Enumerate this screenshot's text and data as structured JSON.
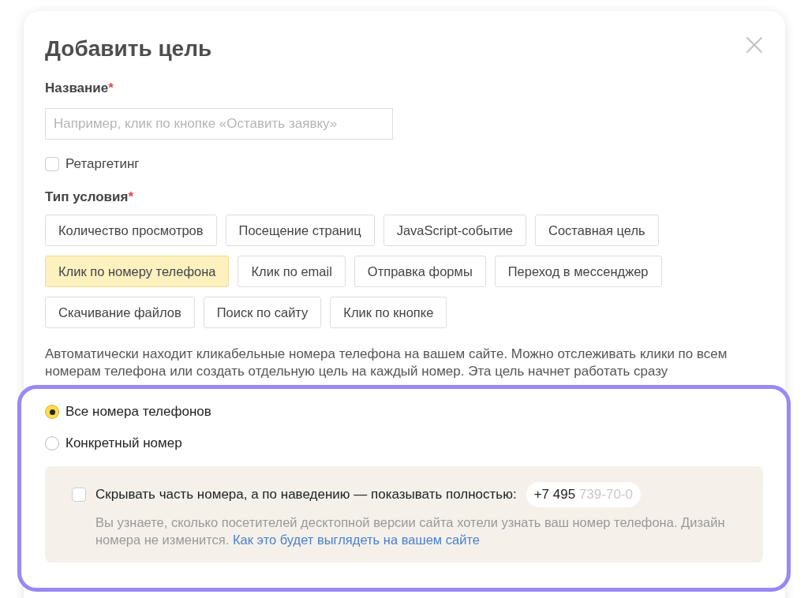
{
  "dialog": {
    "title": "Добавить цель",
    "name_field": {
      "label": "Название",
      "required_mark": "*",
      "placeholder": "Например, клик по кнопке «Оставить заявку»"
    },
    "retargeting": {
      "label": "Ретаргетинг",
      "checked": false
    },
    "condition_type": {
      "label": "Тип условия",
      "required_mark": "*",
      "options": [
        {
          "label": "Количество просмотров",
          "selected": false
        },
        {
          "label": "Посещение страниц",
          "selected": false
        },
        {
          "label": "JavaScript-событие",
          "selected": false
        },
        {
          "label": "Составная цель",
          "selected": false
        },
        {
          "label": "Клик по номеру телефона",
          "selected": true
        },
        {
          "label": "Клик по email",
          "selected": false
        },
        {
          "label": "Отправка формы",
          "selected": false
        },
        {
          "label": "Переход в мессенджер",
          "selected": false
        },
        {
          "label": "Скачивание файлов",
          "selected": false
        },
        {
          "label": "Поиск по сайту",
          "selected": false
        },
        {
          "label": "Клик по кнопке",
          "selected": false
        }
      ]
    },
    "description": "Автоматически находит кликабельные номера телефона на вашем сайте. Можно отслеживать клики по всем номерам телефона или создать отдельную цель на каждый номер. Эта цель начнет работать сразу"
  },
  "highlight": {
    "radios": [
      {
        "label": "Все номера телефонов",
        "selected": true
      },
      {
        "label": "Конкретный номер",
        "selected": false
      }
    ],
    "hide_number": {
      "label": "Скрывать часть номера, а по наведению — показывать полностью:",
      "checked": false,
      "phone_visible": "+7 495",
      "phone_hidden": "739-70-0",
      "hint": "Вы узнаете, сколько посетителей десктопной версии сайта хотели узнать ваш номер телефона. Дизайн номера не изменится.",
      "link": "Как это будет выглядеть на вашем сайте"
    }
  }
}
